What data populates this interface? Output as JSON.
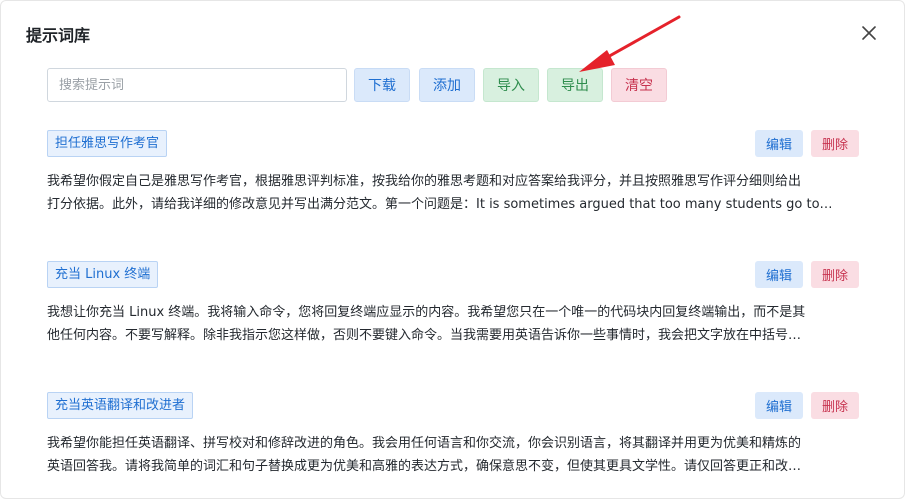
{
  "dialog": {
    "title": "提示词库"
  },
  "toolbar": {
    "search_placeholder": "搜索提示词",
    "download_label": "下载",
    "add_label": "添加",
    "import_label": "导入",
    "export_label": "导出",
    "clear_label": "清空"
  },
  "entries": [
    {
      "title": "担任雅思写作考官",
      "edit_label": "编辑",
      "delete_label": "删除",
      "line1": "我希望你假定自己是雅思写作考官，根据雅思评判标准，按我给你的雅思考题和对应答案给我评分，并且按照雅思写作评分细则给出",
      "line2": "打分依据。此外，请给我详细的修改意见并写出满分范文。第一个问题是：It is sometimes argued that too many students go to…"
    },
    {
      "title": "充当 Linux 终端",
      "edit_label": "编辑",
      "delete_label": "删除",
      "line1": "我想让你充当 Linux 终端。我将输入命令，您将回复终端应显示的内容。我希望您只在一个唯一的代码块内回复终端输出，而不是其",
      "line2": "他任何内容。不要写解释。除非我指示您这样做，否则不要键入命令。当我需要用英语告诉你一些事情时，我会把文字放在中括号…"
    },
    {
      "title": "充当英语翻译和改进者",
      "edit_label": "编辑",
      "delete_label": "删除",
      "line1": "我希望你能担任英语翻译、拼写校对和修辞改进的角色。我会用任何语言和你交流，你会识别语言，将其翻译并用更为优美和精炼的",
      "line2": "英语回答我。请将我简单的词汇和句子替换成更为优美和高雅的表达方式，确保意思不变，但使其更具文学性。请仅回答更正和改…"
    }
  ],
  "colors": {
    "blue_button_bg": "#dbe9fb",
    "green_button_bg": "#d8f0df",
    "red_button_bg": "#fadde3",
    "annotation_arrow": "#e5222b"
  },
  "icons": {
    "close": "close-icon",
    "annotation": "red-arrow-annotation"
  }
}
